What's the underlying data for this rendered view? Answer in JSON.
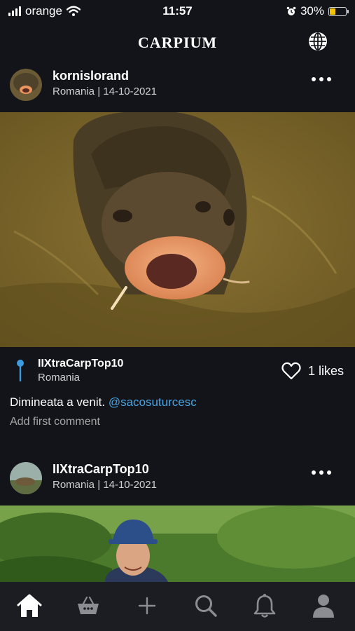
{
  "status_bar": {
    "carrier": "orange",
    "time": "11:57",
    "battery_percent": "30%",
    "battery_level": 0.3,
    "icons": [
      "signal-icon",
      "wifi-icon",
      "alarm-icon",
      "battery-icon"
    ]
  },
  "header": {
    "title": "CARPIUM",
    "right_icon": "globe-icon"
  },
  "posts": [
    {
      "username": "kornislorand",
      "meta": "Romania | 14-10-2021",
      "location": {
        "name": "IIXtraCarpTop10",
        "country": "Romania"
      },
      "likes": "1 likes",
      "caption_text": "Dimineata a venit.",
      "caption_mention": "@sacosuturcesc",
      "add_comment": "Add first comment"
    },
    {
      "username": "IIXtraCarpTop10",
      "meta": "Romania | 14-10-2021"
    }
  ],
  "tab_bar": {
    "items": [
      "home-icon",
      "basket-icon",
      "plus-icon",
      "search-icon",
      "bell-icon",
      "profile-icon"
    ],
    "active": "home-icon"
  },
  "colors": {
    "background": "#121419",
    "tab_bar": "#1c1d22",
    "mention": "#4aa3e0",
    "pin": "#3d9be0",
    "battery": "#f5c400"
  }
}
